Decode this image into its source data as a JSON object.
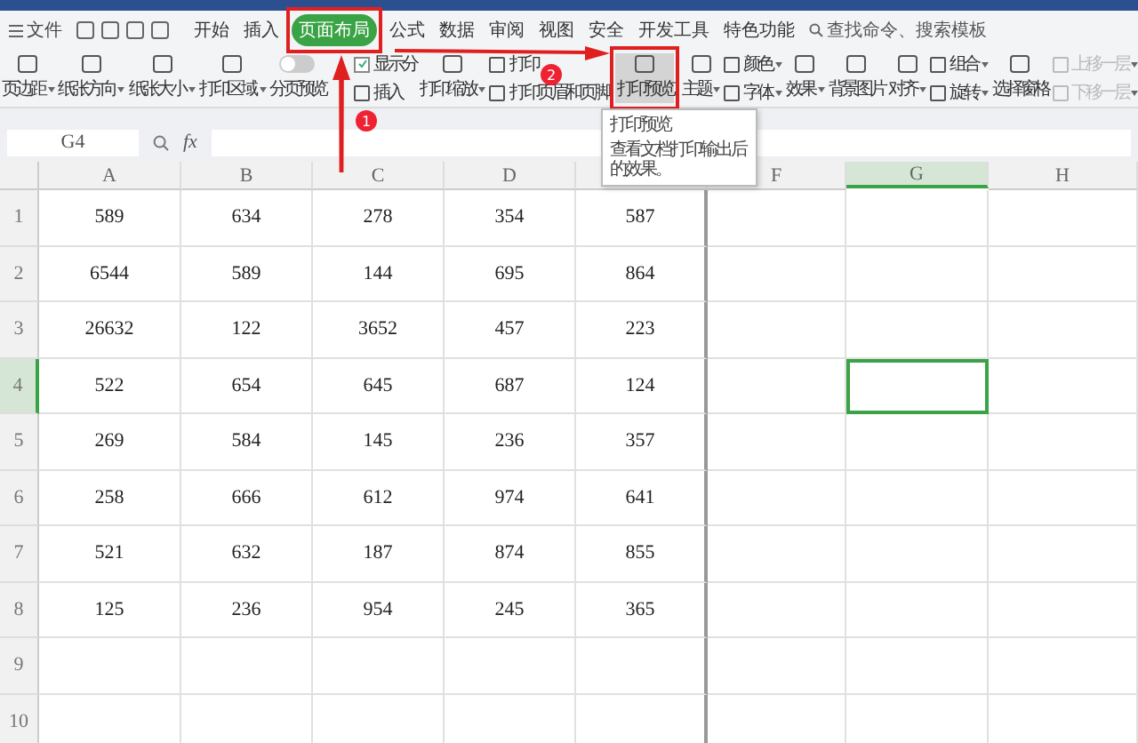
{
  "menu": {
    "file": "文件",
    "tabs": [
      {
        "label": "开始",
        "selected": false
      },
      {
        "label": "插入",
        "selected": false
      },
      {
        "label": "页面布局",
        "selected": true
      },
      {
        "label": "公式",
        "selected": false
      },
      {
        "label": "数据",
        "selected": false
      },
      {
        "label": "审阅",
        "selected": false
      },
      {
        "label": "视图",
        "selected": false
      },
      {
        "label": "安全",
        "selected": false
      },
      {
        "label": "开发工具",
        "selected": false
      },
      {
        "label": "特色功能",
        "selected": false
      }
    ],
    "search": {
      "placeholder": "查找命令、搜索模板"
    }
  },
  "toolbar": [
    {
      "kind": "big",
      "label": "页边距",
      "dropdown": true
    },
    {
      "kind": "big",
      "label": "纸张方向",
      "dropdown": true
    },
    {
      "kind": "big",
      "label": "纸张大小",
      "dropdown": true
    },
    {
      "kind": "big",
      "label": "打印区域",
      "dropdown": true
    },
    {
      "kind": "switch",
      "label": "分页预览",
      "on": false
    },
    {
      "kind": "pair",
      "items": [
        {
          "kind": "check",
          "label": "显示分",
          "checked": true
        },
        {
          "kind": "small",
          "label": "插入",
          "dropdown": false
        }
      ]
    },
    {
      "kind": "big",
      "label": "打印缩放",
      "dropdown": true
    },
    {
      "kind": "pair",
      "items": [
        {
          "kind": "small",
          "label": "打印",
          "dropdown": false
        },
        {
          "kind": "small",
          "label": "打印页眉和页脚",
          "dropdown": false
        }
      ]
    },
    {
      "kind": "big",
      "label": "打印预览",
      "dropdown": false,
      "selected": true
    },
    {
      "kind": "big",
      "label": "主题",
      "dropdown": true
    },
    {
      "kind": "pair",
      "items": [
        {
          "kind": "small",
          "label": "颜色",
          "dropdown": true
        },
        {
          "kind": "small",
          "label": "字体",
          "dropdown": true
        }
      ]
    },
    {
      "kind": "big",
      "label": "效果",
      "dropdown": true
    },
    {
      "kind": "big",
      "label": "背景图片",
      "dropdown": false
    },
    {
      "kind": "big",
      "label": "对齐",
      "dropdown": true
    },
    {
      "kind": "pair",
      "items": [
        {
          "kind": "small",
          "label": "组合",
          "dropdown": true
        },
        {
          "kind": "small",
          "label": "旋转",
          "dropdown": true
        }
      ]
    },
    {
      "kind": "big",
      "label": "选择窗格",
      "dropdown": false
    },
    {
      "kind": "pair",
      "items": [
        {
          "kind": "small",
          "label": "上移一层",
          "dropdown": true,
          "disabled": true
        },
        {
          "kind": "small",
          "label": "下移一层",
          "dropdown": true,
          "disabled": true
        }
      ]
    }
  ],
  "tooltip": {
    "title": "打印预览",
    "text": "查看文档打印输出后的效果。"
  },
  "formula_bar": {
    "cell": "G4",
    "fx": "fx"
  },
  "sheet": {
    "columns": [
      {
        "label": "A",
        "selected": false
      },
      {
        "label": "B",
        "selected": false
      },
      {
        "label": "C",
        "selected": false
      },
      {
        "label": "D",
        "selected": false
      },
      {
        "selected": false
      },
      {
        "label": "F",
        "selected": false
      },
      {
        "label": "G",
        "selected": true
      },
      {
        "label": "H",
        "selected": false
      }
    ],
    "rows": [
      {
        "label": "1",
        "selected": false,
        "cells": [
          "589",
          "634",
          "278",
          "354",
          "587"
        ]
      },
      {
        "label": "2",
        "selected": false,
        "cells": [
          "6544",
          "589",
          "144",
          "695",
          "864"
        ]
      },
      {
        "label": "3",
        "selected": false,
        "cells": [
          "26632",
          "122",
          "3652",
          "457",
          "223"
        ]
      },
      {
        "label": "4",
        "selected": true,
        "cells": [
          "522",
          "654",
          "645",
          "687",
          "124"
        ]
      },
      {
        "label": "5",
        "selected": false,
        "cells": [
          "269",
          "584",
          "145",
          "236",
          "357"
        ]
      },
      {
        "label": "6",
        "selected": false,
        "cells": [
          "258",
          "666",
          "612",
          "974",
          "641"
        ]
      },
      {
        "label": "7",
        "selected": false,
        "cells": [
          "521",
          "632",
          "187",
          "874",
          "855"
        ]
      },
      {
        "label": "8",
        "selected": false,
        "cells": [
          "125",
          "236",
          "954",
          "245",
          "365"
        ]
      },
      {
        "label": "9",
        "selected": false,
        "cells": []
      },
      {
        "label": "10",
        "selected": false,
        "cells": []
      }
    ]
  },
  "annotations": [
    {
      "label": "1"
    },
    {
      "label": "2"
    }
  ]
}
